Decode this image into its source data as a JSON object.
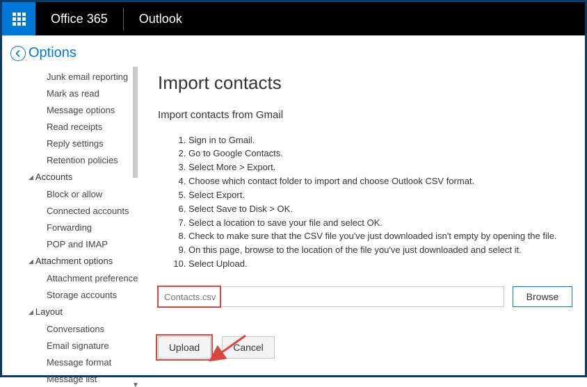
{
  "header": {
    "brand": "Office 365",
    "app": "Outlook"
  },
  "options_label": "Options",
  "sidebar": {
    "items_top": [
      "Junk email reporting",
      "Mark as read",
      "Message options",
      "Read receipts",
      "Reply settings",
      "Retention policies"
    ],
    "group_accounts": "Accounts",
    "accounts_items": [
      "Block or allow",
      "Connected accounts",
      "Forwarding",
      "POP and IMAP"
    ],
    "group_attachment": "Attachment options",
    "attachment_items": [
      "Attachment preference",
      "Storage accounts"
    ],
    "group_layout": "Layout",
    "layout_items": [
      "Conversations",
      "Email signature",
      "Message format",
      "Message list"
    ]
  },
  "page": {
    "title": "Import contacts",
    "subtitle": "Import contacts from Gmail",
    "steps": [
      "Sign in to Gmail.",
      "Go to Google Contacts.",
      "Select More > Export.",
      "Choose which contact folder to import and choose Outlook CSV format.",
      "Select Export.",
      "Select Save to Disk > OK.",
      "Select a location to save your file and select OK.",
      "Check to make sure that the CSV file you've just downloaded isn't empty by opening the file.",
      "On this page, browse to the location of the file you've just downloaded and select it.",
      "Select Upload."
    ],
    "file_placeholder": "Contacts.csv",
    "browse_label": "Browse",
    "upload_label": "Upload",
    "cancel_label": "Cancel"
  }
}
